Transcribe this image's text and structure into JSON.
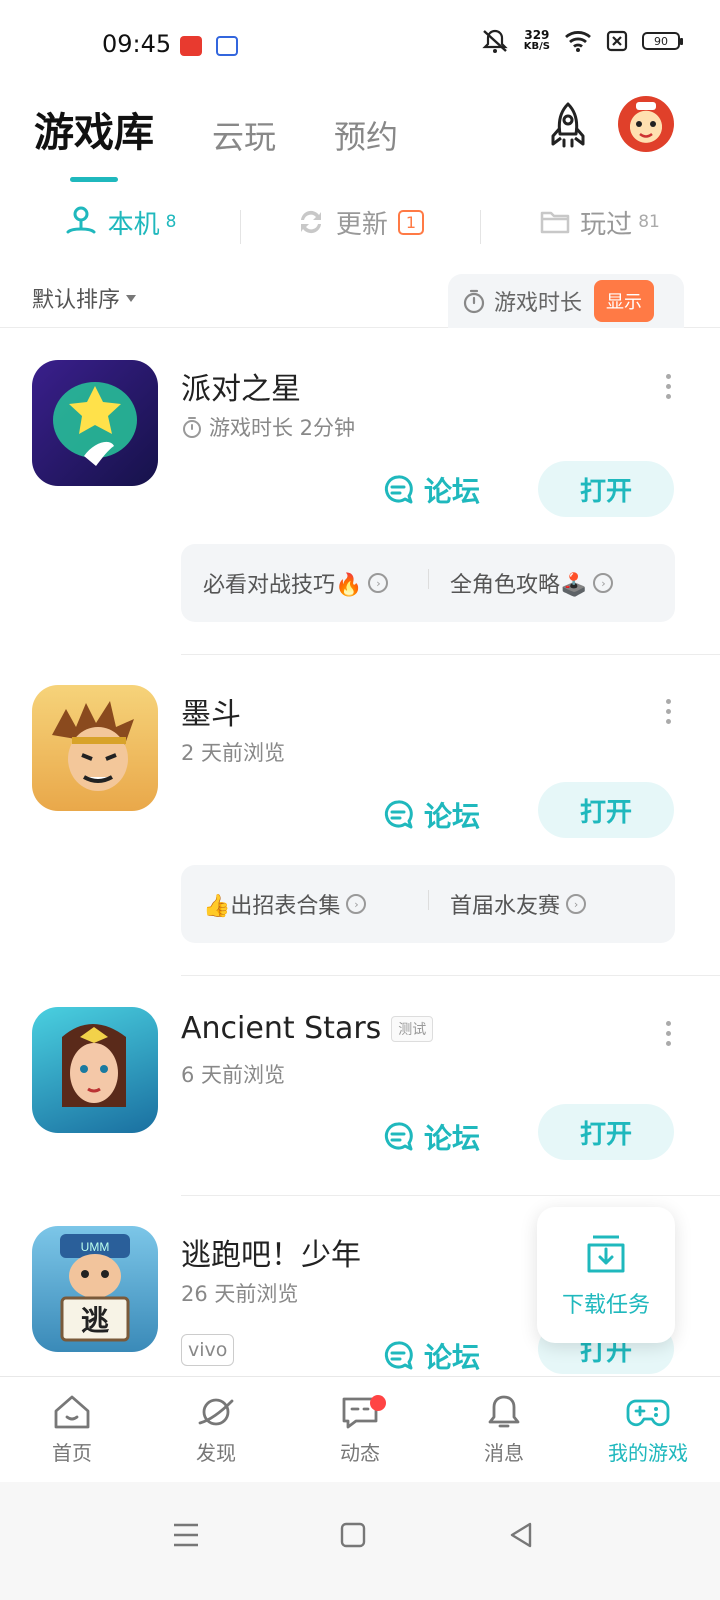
{
  "status_bar": {
    "time": "09:45",
    "net_speed_value": "329",
    "net_speed_unit": "KB/S",
    "battery": "90",
    "icons": [
      "toutiao-app-icon",
      "baidu-app-icon",
      "mute-icon",
      "wifi-icon",
      "sim-x-icon",
      "battery-icon"
    ]
  },
  "top_tabs": {
    "items": [
      "游戏库",
      "云玩",
      "预约"
    ],
    "active": 0
  },
  "sub_tabs": {
    "local": {
      "label": "本机",
      "count": "8"
    },
    "update": {
      "label": "更新",
      "count": "1"
    },
    "played": {
      "label": "玩过",
      "count": "81"
    }
  },
  "sort": {
    "label": "默认排序",
    "playtime_label": "游戏时长",
    "show_label": "显示"
  },
  "games": [
    {
      "title": "派对之星",
      "subtitle": "游戏时长 2分钟",
      "forum": "论坛",
      "open": "打开",
      "guides": [
        "必看对战技巧🔥",
        "全角色攻略🕹️"
      ]
    },
    {
      "title": "墨斗",
      "subtitle": "2 天前浏览",
      "forum": "论坛",
      "open": "打开",
      "guides": [
        "👍出招表合集",
        "首届水友赛"
      ]
    },
    {
      "title": "Ancient Stars",
      "tag": "测试",
      "subtitle": "6 天前浏览",
      "forum": "论坛",
      "open": "打开"
    },
    {
      "title": "逃跑吧！少年",
      "subtitle": "26 天前浏览",
      "tag": "vivo",
      "forum": "论坛",
      "open": "打开",
      "icon_text": "逃",
      "icon_cap_text": "UMM"
    }
  ],
  "download_task": {
    "label": "下载任务"
  },
  "bottom_nav": {
    "items": [
      "首页",
      "发现",
      "动态",
      "消息",
      "我的游戏"
    ],
    "active": 4
  },
  "colors": {
    "accent": "#1fb8bd",
    "orange": "#ff7a45",
    "badge_red": "#ff4444"
  }
}
